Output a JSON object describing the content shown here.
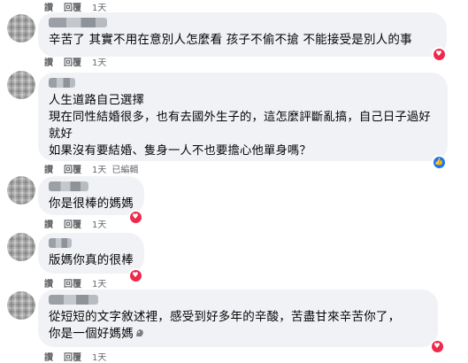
{
  "actions": {
    "like": "讚",
    "reply": "回覆"
  },
  "reactions": {
    "heart_color": "#f0284a",
    "like_color": "#1877f2"
  },
  "comments": [
    {
      "name": "",
      "text": "辛苦了 其實不用在意別人怎麼看 孩子不偷不搶 不能接受是別人的事",
      "time": "1天",
      "edited": "",
      "reaction": "heart-icon"
    },
    {
      "name": "",
      "text": "人生道路自己選擇\n現在同性結婚很多，也有去國外生子的，這怎麼評斷亂搞，自己日子過好就好\n如果沒有要結婚、隻身一人不也要擔心他單身嗎？",
      "time": "1天",
      "edited": "已編輯",
      "reaction": "like-icon"
    },
    {
      "name": "",
      "text": "你是很棒的媽媽",
      "time": "1天",
      "edited": "",
      "reaction": "heart-icon"
    },
    {
      "name": "",
      "text": "版媽你真的很棒",
      "time": "1天",
      "edited": "",
      "reaction": "heart-icon"
    },
    {
      "name": "",
      "text": "從短短的文字敘述裡，感受到好多年的辛酸，苦盡甘來辛苦你了，\n你是一個好媽媽",
      "time": "1天",
      "edited": "",
      "reaction": "heart-icon"
    }
  ]
}
